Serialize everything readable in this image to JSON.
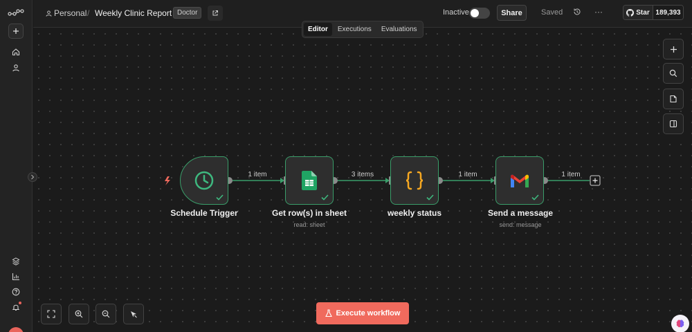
{
  "colors": {
    "accent": "#f06a5d",
    "node_border": "#3a9e6a",
    "connection": "#3a9e6a",
    "canvas_bg": "#1b1b1b"
  },
  "header": {
    "project": "Personal",
    "separator": "/",
    "workflow_name": "Weekly Clinic Report",
    "tag": "Doctor",
    "status_label": "Inactive",
    "share_label": "Share",
    "saved_label": "Saved",
    "more_label": "···",
    "github": {
      "star_label": "Star",
      "count": "189,393"
    }
  },
  "tabs": [
    {
      "label": "Editor",
      "active": true
    },
    {
      "label": "Executions",
      "active": false
    },
    {
      "label": "Evaluations",
      "active": false
    }
  ],
  "nodes": [
    {
      "title": "Schedule Trigger",
      "subtitle": "",
      "icon": "clock-icon"
    },
    {
      "title": "Get row(s) in sheet",
      "subtitle": "read: sheet",
      "icon": "google-sheets-icon"
    },
    {
      "title": "weekly status",
      "subtitle": "",
      "icon": "code-braces-icon"
    },
    {
      "title": "Send a message",
      "subtitle": "send: message",
      "icon": "gmail-icon"
    }
  ],
  "connections": [
    {
      "label": "1 item"
    },
    {
      "label": "3 items"
    },
    {
      "label": "1 item"
    },
    {
      "label": "1 item"
    }
  ],
  "footer": {
    "execute_label": "Execute workflow"
  }
}
